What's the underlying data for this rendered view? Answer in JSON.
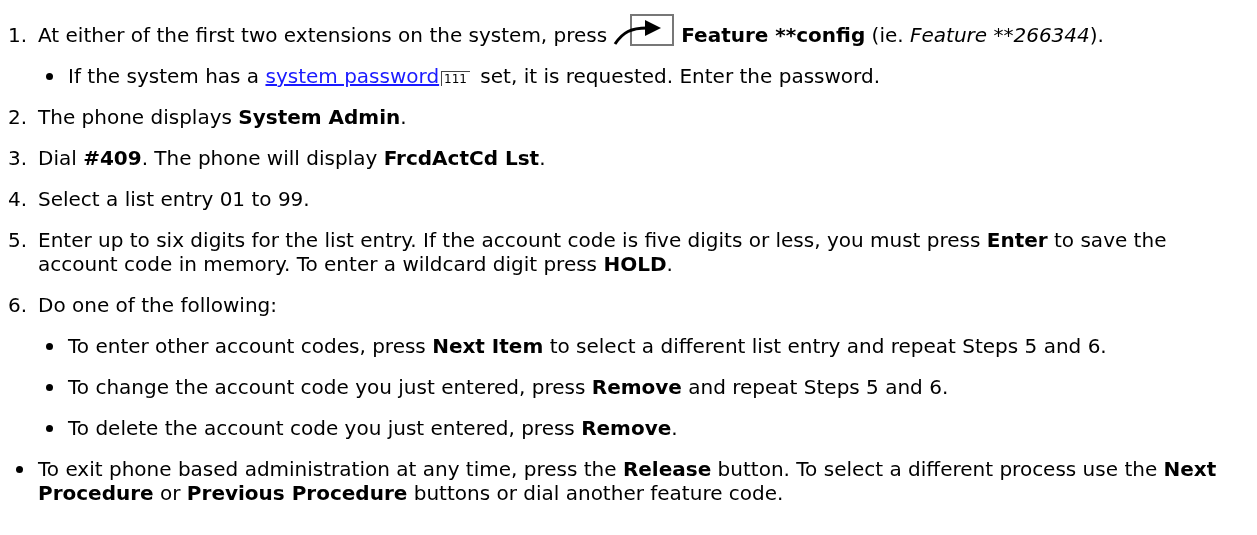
{
  "steps": [
    {
      "number": "1.",
      "segments": [
        {
          "kind": "text",
          "text": "At either of the first two extensions on the system, press"
        },
        {
          "kind": "feature-icon"
        },
        {
          "kind": "bold",
          "text": "Feature **config"
        },
        {
          "kind": "text",
          "text": " (ie. "
        },
        {
          "kind": "italic",
          "text": "Feature **266344"
        },
        {
          "kind": "text",
          "text": ")."
        }
      ],
      "bullets": [
        {
          "segments": [
            {
              "kind": "text",
              "text": "If the system has a "
            },
            {
              "kind": "link",
              "text": "system password"
            },
            {
              "kind": "ref",
              "text": "111"
            },
            {
              "kind": "text",
              "text": " set, it is requested. Enter the password."
            }
          ]
        }
      ]
    },
    {
      "number": "2.",
      "segments": [
        {
          "kind": "text",
          "text": "The phone displays **System Admin**."
        }
      ]
    },
    {
      "number": "3.",
      "segments": [
        {
          "kind": "text",
          "text": "Dial **#409**. The phone will display **FrcdActCd Lst**."
        }
      ]
    },
    {
      "number": "4.",
      "segments": [
        {
          "kind": "text",
          "text": "Select a list entry 01 to 99."
        }
      ]
    },
    {
      "number": "5.",
      "segments": [
        {
          "kind": "text",
          "text": "Enter up to six digits for the list entry. If the account code is five digits or less, you must press **Enter** to save the account code in memory. To enter a wildcard digit press **HOLD**."
        }
      ]
    },
    {
      "number": "6.",
      "segments": [
        {
          "kind": "text",
          "text": "Do one of the following:"
        }
      ],
      "bullets": [
        {
          "segments": [
            {
              "kind": "text",
              "text": "To enter other account codes, press **Next Item** to select a different list entry and repeat Steps 5 and 6."
            }
          ]
        },
        {
          "segments": [
            {
              "kind": "text",
              "text": "To change the account code you just entered, press **Remove** and repeat Steps 5 and 6."
            }
          ]
        },
        {
          "segments": [
            {
              "kind": "text",
              "text": "To delete the account code you just entered, press **Remove**."
            }
          ]
        }
      ]
    }
  ],
  "notes": [
    {
      "segments": [
        {
          "kind": "text",
          "text": "To exit phone based administration at any time, press the **Release** button. To select a different process use the **Next Procedure** or **Previous Procedure** buttons or dial another feature code."
        }
      ]
    }
  ]
}
